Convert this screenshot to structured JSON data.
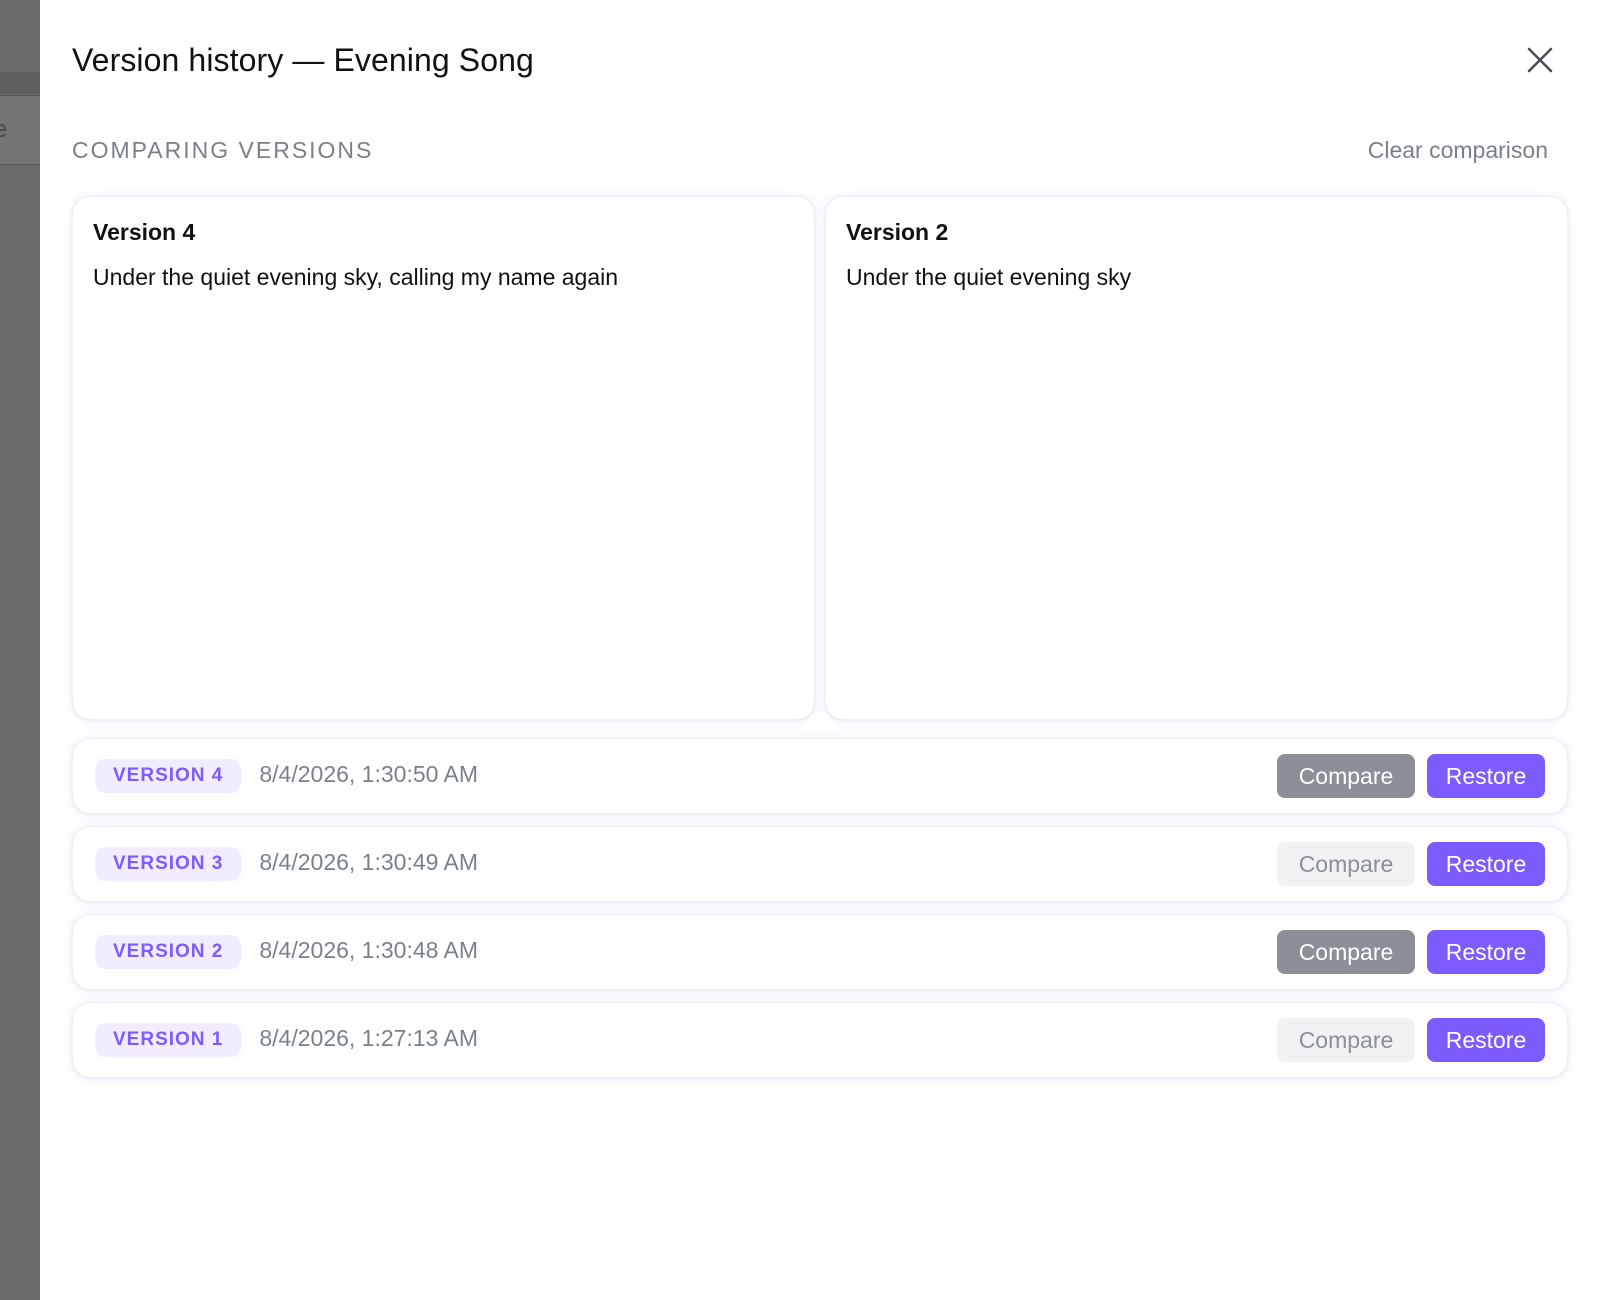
{
  "backdrop": {
    "partial_text": "e"
  },
  "modal": {
    "title": "Version history — Evening Song"
  },
  "comparison": {
    "label": "COMPARING VERSIONS",
    "clear_label": "Clear comparison",
    "left": {
      "title": "Version 4",
      "text": "Under the quiet evening sky, calling my name again"
    },
    "right": {
      "title": "Version 2",
      "text": "Under the quiet evening sky"
    }
  },
  "versions": [
    {
      "badge": "VERSION 4",
      "timestamp": "8/4/2026, 1:30:50 AM",
      "compare_label": "Compare",
      "restore_label": "Restore",
      "selected": true
    },
    {
      "badge": "VERSION 3",
      "timestamp": "8/4/2026, 1:30:49 AM",
      "compare_label": "Compare",
      "restore_label": "Restore",
      "selected": false
    },
    {
      "badge": "VERSION 2",
      "timestamp": "8/4/2026, 1:30:48 AM",
      "compare_label": "Compare",
      "restore_label": "Restore",
      "selected": true
    },
    {
      "badge": "VERSION 1",
      "timestamp": "8/4/2026, 1:27:13 AM",
      "compare_label": "Compare",
      "restore_label": "Restore",
      "selected": false
    }
  ],
  "colors": {
    "accent": "#7c5cff",
    "badge_bg": "#f1ecff",
    "compare_active_bg": "#8a8f98",
    "compare_inactive_bg": "#f2f2f4",
    "muted_text": "#7a808a"
  },
  "icons": {
    "close": "close-icon"
  }
}
